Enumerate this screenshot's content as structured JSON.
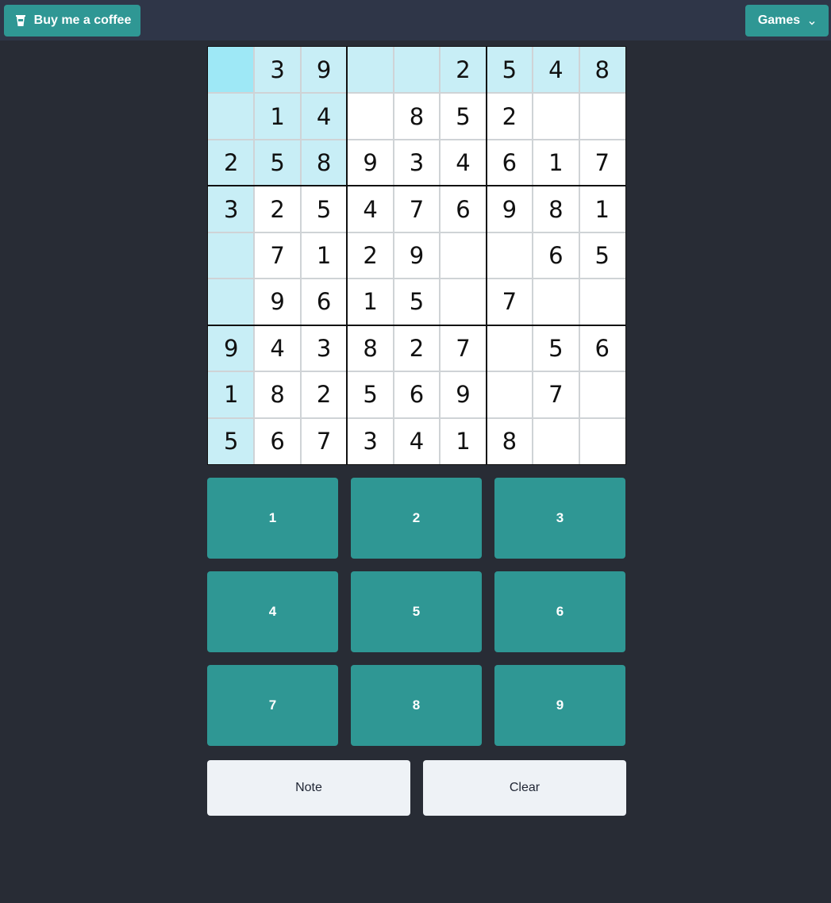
{
  "header": {
    "coffee_label": "Buy me a coffee",
    "games_label": "Games",
    "coffee_icon": "coffee-cup-icon",
    "games_icon": "chevron-down-icon",
    "teal": "#2f9794",
    "bar_bg": "#2f3648"
  },
  "board": {
    "grid": [
      [
        "",
        "3",
        "9",
        "",
        "",
        "2",
        "5",
        "4",
        "8"
      ],
      [
        "",
        "1",
        "4",
        "",
        "8",
        "5",
        "2",
        "",
        ""
      ],
      [
        "2",
        "5",
        "8",
        "9",
        "3",
        "4",
        "6",
        "1",
        "7"
      ],
      [
        "3",
        "2",
        "5",
        "4",
        "7",
        "6",
        "9",
        "8",
        "1"
      ],
      [
        "",
        "7",
        "1",
        "2",
        "9",
        "",
        "",
        "6",
        "5"
      ],
      [
        "",
        "9",
        "6",
        "1",
        "5",
        "",
        "7",
        "",
        ""
      ],
      [
        "9",
        "4",
        "3",
        "8",
        "2",
        "7",
        "",
        "5",
        "6"
      ],
      [
        "1",
        "8",
        "2",
        "5",
        "6",
        "9",
        "",
        "7",
        ""
      ],
      [
        "5",
        "6",
        "7",
        "3",
        "4",
        "1",
        "8",
        "",
        ""
      ]
    ],
    "selected": {
      "row": 0,
      "col": 0
    },
    "highlight_color": "#c8eef6",
    "selected_color": "#9ee8f6"
  },
  "numpad": [
    "1",
    "2",
    "3",
    "4",
    "5",
    "6",
    "7",
    "8",
    "9"
  ],
  "actions": {
    "note_label": "Note",
    "clear_label": "Clear"
  }
}
